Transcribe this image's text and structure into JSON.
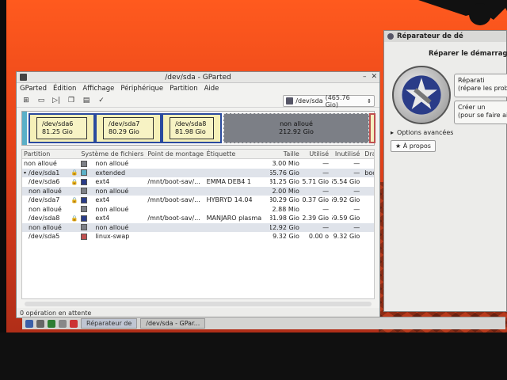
{
  "gparted": {
    "title": "/dev/sda - GParted",
    "menu": [
      "GParted",
      "Édition",
      "Affichage",
      "Périphérique",
      "Partition",
      "Aide"
    ],
    "device": {
      "name": "/dev/sda",
      "size": "(465.76 Gio)"
    },
    "diskmap": [
      {
        "name": "/dev/sda6",
        "size": "81.25 Gio"
      },
      {
        "name": "/dev/sda7",
        "size": "80.29 Gio"
      },
      {
        "name": "/dev/sda8",
        "size": "81.98 Gio"
      },
      {
        "name": "non alloué",
        "size": "212.92 Gio"
      }
    ],
    "columns": [
      "Partition",
      "Système de fichiers",
      "Point de montage",
      "Étiquette",
      "Taille",
      "Utilisé",
      "Inutilisé",
      "Dra"
    ],
    "rows": [
      {
        "partition": "non alloué",
        "fs": "non alloué",
        "mount": "",
        "label": "",
        "size": "3.00 Mio",
        "used": "—",
        "unused": "—",
        "flags": "",
        "color": "#7c7f86"
      },
      {
        "partition": "/dev/sda1",
        "fs": "extended",
        "mount": "",
        "label": "",
        "size": "465.76 Gio",
        "used": "—",
        "unused": "—",
        "flags": "boo",
        "color": "#5ab0c8"
      },
      {
        "partition": "/dev/sda6",
        "fs": "ext4",
        "mount": "/mnt/boot-sav/...",
        "label": "EMMA DEB4 1",
        "size": "81.25 Gio",
        "used": "15.71 Gio",
        "unused": "65.54 Gio",
        "flags": "",
        "color": "#2a3c88"
      },
      {
        "partition": "non alloué",
        "fs": "non alloué",
        "mount": "",
        "label": "",
        "size": "2.00 Mio",
        "used": "—",
        "unused": "—",
        "flags": "",
        "color": "#7c7f86"
      },
      {
        "partition": "/dev/sda7",
        "fs": "ext4",
        "mount": "/mnt/boot-sav/...",
        "label": "HYBRYD 14.04",
        "size": "80.29 Gio",
        "used": "10.37 Gio",
        "unused": "69.92 Gio",
        "flags": "",
        "color": "#2a3c88"
      },
      {
        "partition": "non alloué",
        "fs": "non alloué",
        "mount": "",
        "label": "",
        "size": "2.88 Mio",
        "used": "—",
        "unused": "—",
        "flags": "",
        "color": "#7c7f86"
      },
      {
        "partition": "/dev/sda8",
        "fs": "ext4",
        "mount": "/mnt/boot-sav/...",
        "label": "MANJARO plasma",
        "size": "81.98 Gio",
        "used": "22.39 Gio",
        "unused": "59.59 Gio",
        "flags": "",
        "color": "#2a3c88"
      },
      {
        "partition": "non alloué",
        "fs": "non alloué",
        "mount": "",
        "label": "",
        "size": "212.92 Gio",
        "used": "—",
        "unused": "—",
        "flags": "",
        "color": "#7c7f86"
      },
      {
        "partition": "/dev/sda5",
        "fs": "linux-swap",
        "mount": "",
        "label": "",
        "size": "9.32 Gio",
        "used": "0.00 o",
        "unused": "9.32 Gio",
        "flags": "",
        "color": "#c05050"
      }
    ],
    "status": "0 opération en attente"
  },
  "bootrepair": {
    "title": "Réparateur de dé",
    "heading": "Réparer le démarrage d",
    "btn1_line1": "Réparati",
    "btn1_line2": "(répare les prob",
    "btn2_line1": "Créer un",
    "btn2_line2": "(pour se faire ai",
    "advanced": "Options avancées",
    "about": "À propos"
  },
  "taskbar": {
    "task1": "Réparateur de",
    "task2": "/dev/sda - GPar..."
  }
}
